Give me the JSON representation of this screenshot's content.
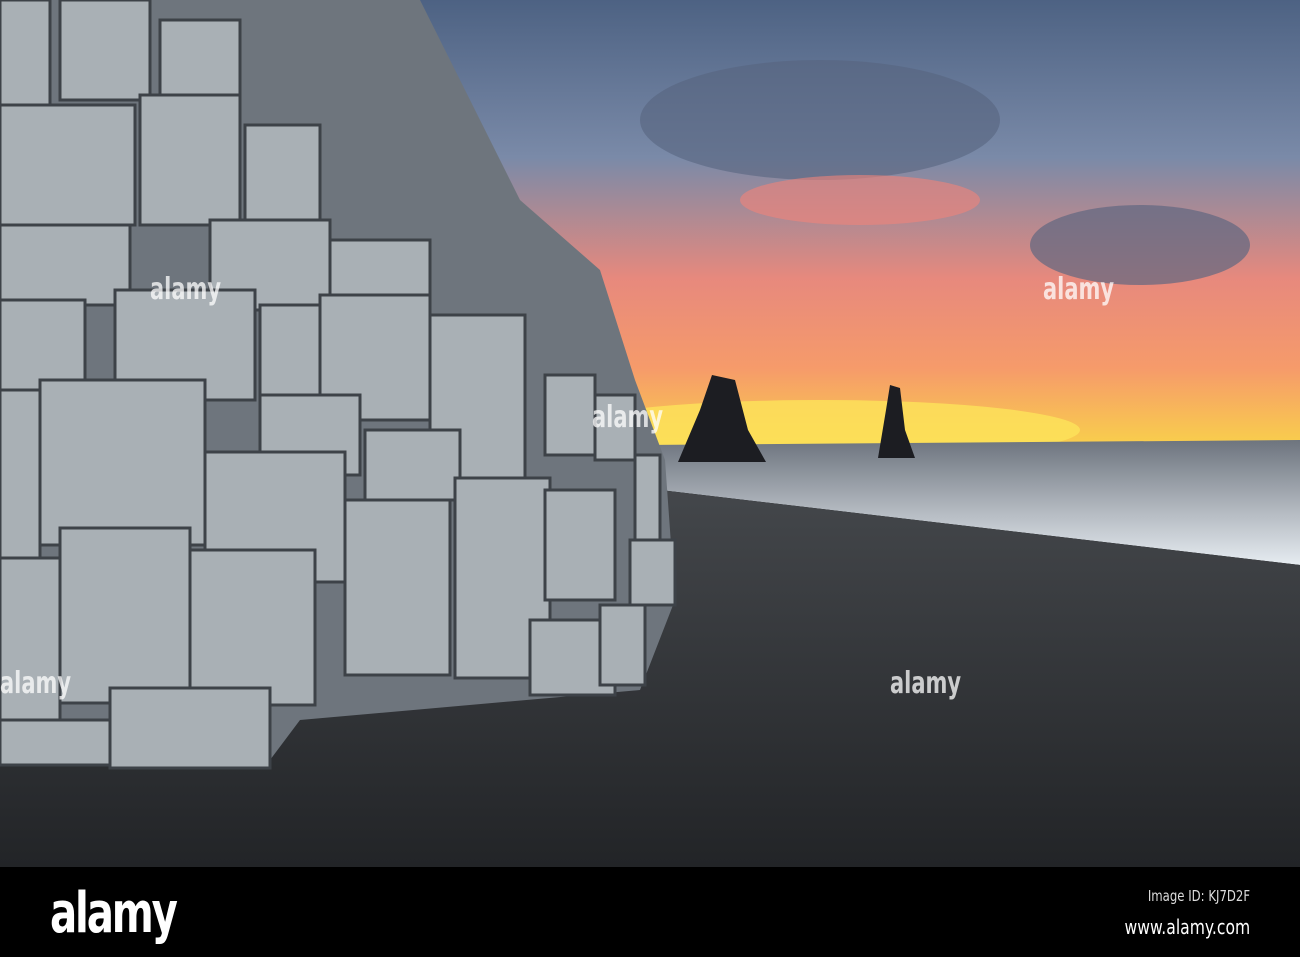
{
  "photo": {
    "watermark": "alamy",
    "colors": {
      "sky_top": "#5a6f8e",
      "sunset": "#f8c64a",
      "glow": "#f07a6a",
      "sea": "#9aa3ad",
      "sand": "#2e3034",
      "basalt": "#8a9096"
    }
  },
  "footer": {
    "logo": "alamy",
    "image_id": "Image ID: KJ7D2F",
    "url": "www.alamy.com"
  }
}
